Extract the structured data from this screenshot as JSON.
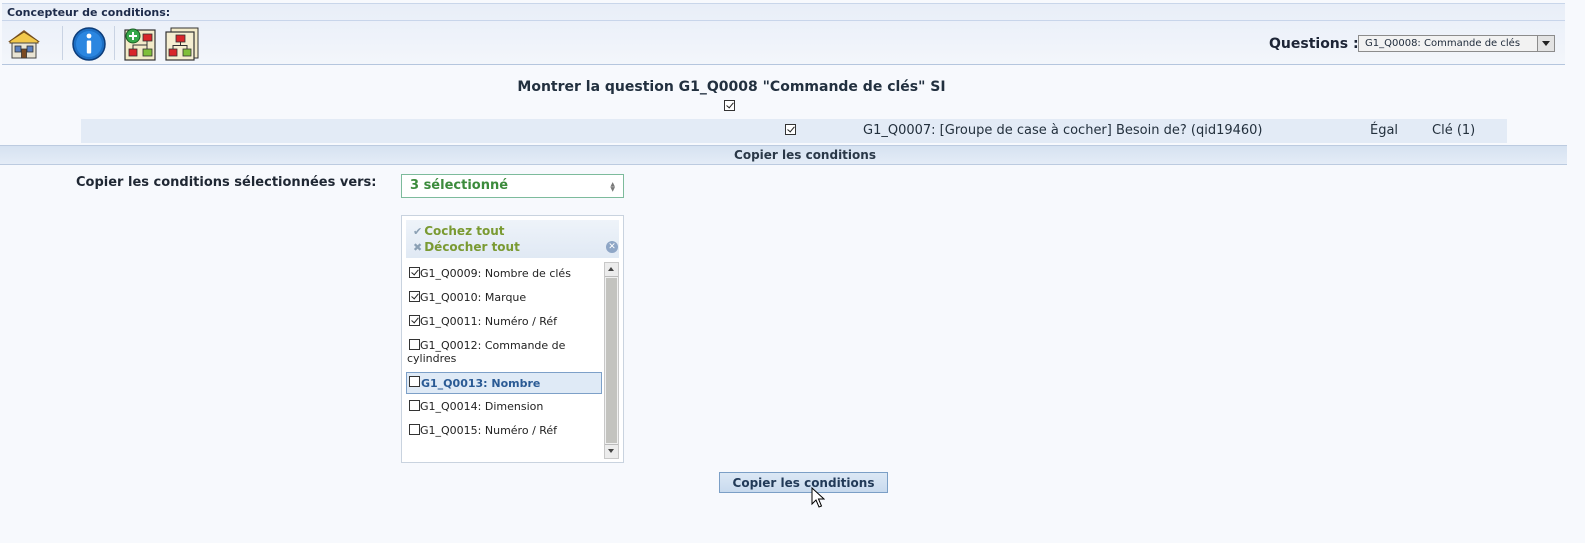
{
  "header": {
    "title": "Concepteur de conditions:",
    "toolbar": [
      {
        "name": "home-icon"
      },
      {
        "name": "info-icon"
      },
      {
        "name": "add-condition-icon"
      },
      {
        "name": "copy-conditions-icon"
      }
    ],
    "questions_label": "Questions :",
    "questions_selected": "G1_Q0008: Commande de clés"
  },
  "condition": {
    "heading": "Montrer la question G1_Q0008 \"Commande de clés\" SI",
    "row": {
      "question": "G1_Q0007: [Groupe de case à cocher] Besoin de? (qid19460)",
      "operator": "Égal",
      "value": "Clé (1)"
    }
  },
  "copy_section": {
    "title": "Copier les conditions",
    "label": "Copier les conditions sélectionnées vers:",
    "selected_summary": "3 sélectionné",
    "check_all": "Cochez tout",
    "uncheck_all": "Décocher tout",
    "options": [
      {
        "label": "G1_Q0009: Nombre de clés",
        "checked": true
      },
      {
        "label": "G1_Q0010: Marque",
        "checked": true
      },
      {
        "label": "G1_Q0011: Numéro / Réf",
        "checked": true
      },
      {
        "label": "G1_Q0012: Commande de",
        "label2": "cylindres",
        "checked": false
      },
      {
        "label": "G1_Q0013: Nombre",
        "checked": false,
        "highlighted": true
      },
      {
        "label": "G1_Q0014: Dimension",
        "checked": false
      },
      {
        "label": "G1_Q0015: Numéro / Réf",
        "checked": false
      }
    ],
    "submit_label": "Copier les conditions"
  },
  "colors": {
    "accent_green": "#3c8b3c",
    "link_green": "#7a9a32",
    "header_bg": "#e8eef8"
  }
}
